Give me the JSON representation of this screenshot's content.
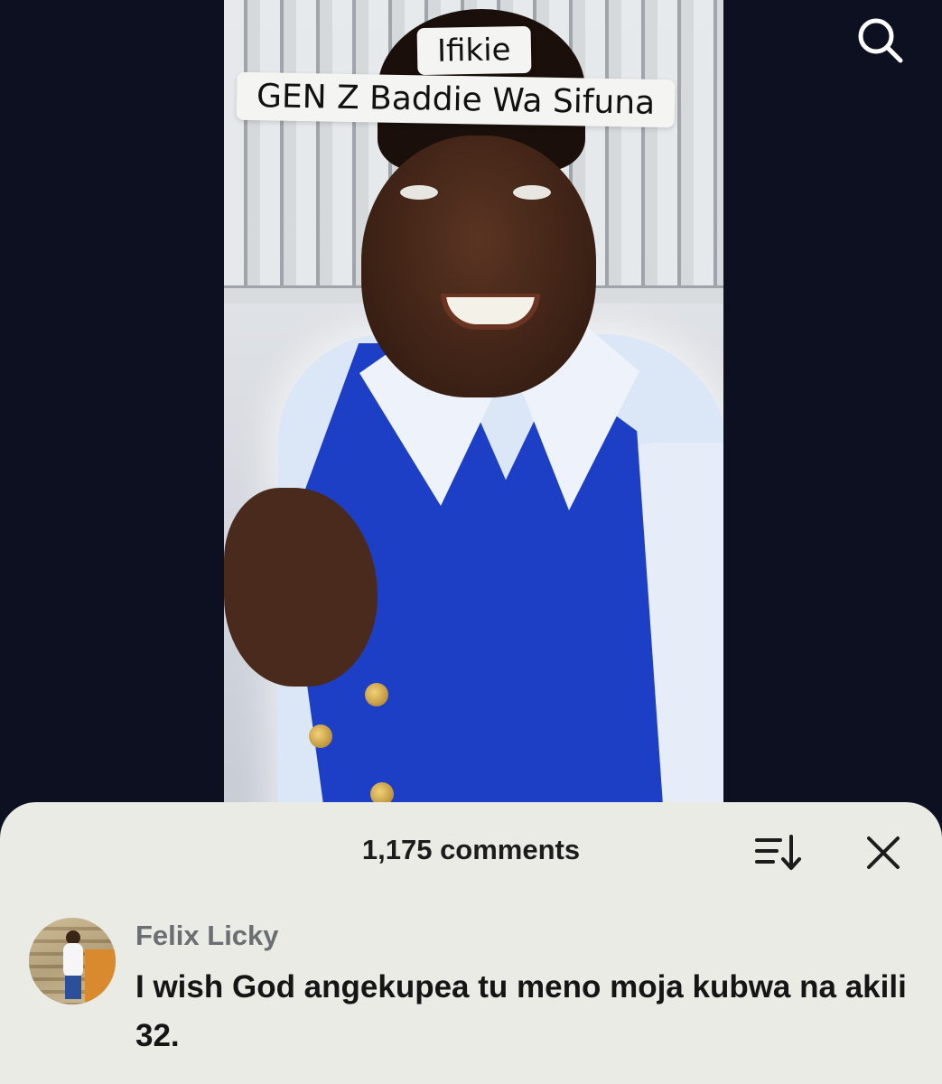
{
  "video": {
    "caption_line1": "Ifikie",
    "caption_line2": "GEN Z Baddie Wa Sifuna"
  },
  "topbar": {
    "search_icon": "search-icon"
  },
  "comments_sheet": {
    "count_label": "1,175 comments",
    "sort_icon": "sort-icon",
    "close_icon": "close-icon",
    "comments": [
      {
        "author": "Felix Licky",
        "text": "I wish God angekupea tu meno moja kubwa na akili 32."
      }
    ]
  },
  "colors": {
    "background": "#0c1020",
    "sheet": "#e9ebe4",
    "vest": "#1d3fc6"
  }
}
